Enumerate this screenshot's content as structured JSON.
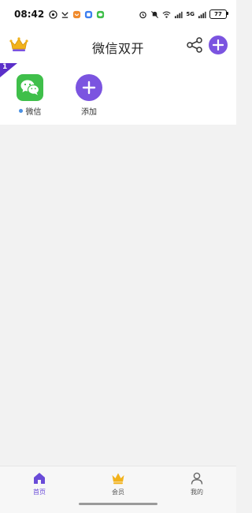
{
  "status_bar": {
    "time": "08:42",
    "battery": "77",
    "network": "5G"
  },
  "header": {
    "title": "微信双开"
  },
  "apps": {
    "badge_number": "1",
    "items": [
      {
        "label": "微信",
        "icon": "wechat-icon"
      },
      {
        "label": "添加",
        "icon": "plus-icon"
      }
    ]
  },
  "tabs": [
    {
      "label": "首页",
      "icon": "home-icon",
      "active": true
    },
    {
      "label": "会员",
      "icon": "crown-icon",
      "active": false
    },
    {
      "label": "我的",
      "icon": "user-icon",
      "active": false
    }
  ],
  "colors": {
    "accent": "#7b54e0",
    "wechat_green": "#3fbf4a",
    "crown_gold": "#f2b21b",
    "badge_purple": "#5b2fc9"
  }
}
